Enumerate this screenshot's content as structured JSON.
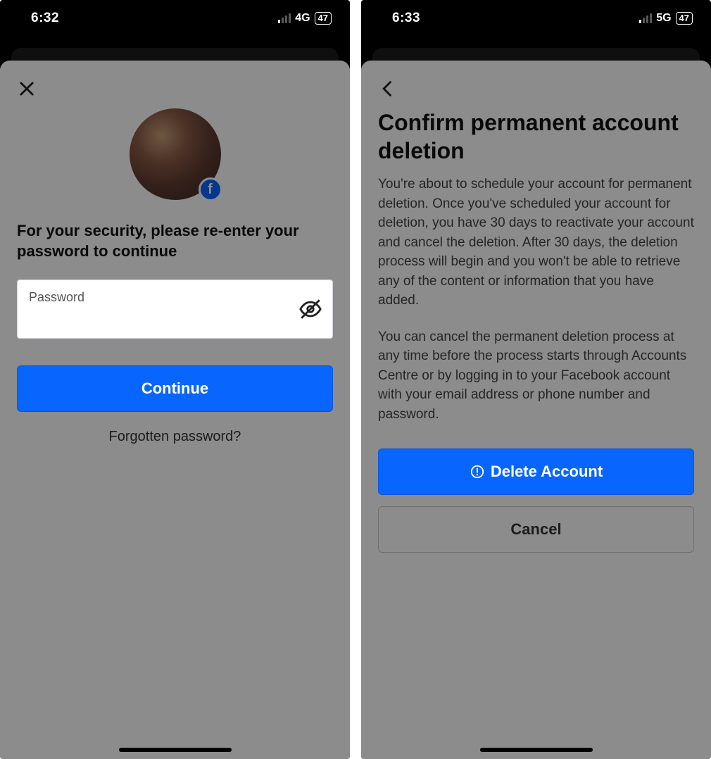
{
  "left": {
    "status": {
      "time": "6:32",
      "network": "4G",
      "battery": "47"
    },
    "heading": "For your security, please re-enter your password to continue",
    "password_label": "Password",
    "continue_label": "Continue",
    "forgot_label": "Forgotten password?"
  },
  "right": {
    "status": {
      "time": "6:33",
      "network": "5G",
      "battery": "47"
    },
    "heading": "Confirm permanent account deletion",
    "paragraph1": "You're about to schedule your account for permanent deletion. Once you've scheduled your account for deletion, you have 30 days to reactivate your account and cancel the deletion. After 30 days, the deletion process will begin and you won't be able to retrieve any of the content or information that you have added.",
    "paragraph2": "You can cancel the permanent deletion process at any time before the process starts through Accounts Centre or by logging in to your Facebook account with your email address or phone number and password.",
    "delete_label": "Delete Account",
    "cancel_label": "Cancel"
  }
}
